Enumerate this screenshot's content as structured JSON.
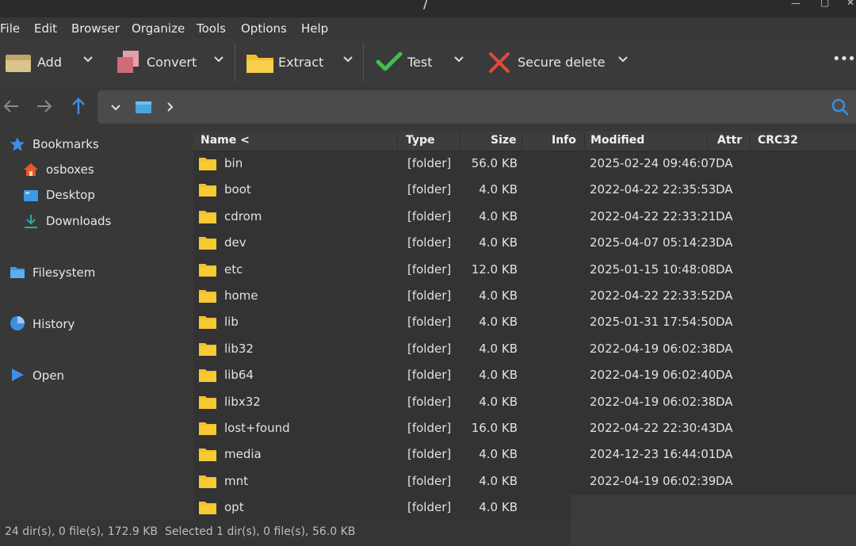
{
  "window": {
    "title": "/"
  },
  "menu": [
    "File",
    "Edit",
    "Browser",
    "Organize",
    "Tools",
    "Options",
    "Help"
  ],
  "toolbar": {
    "add": "Add",
    "convert": "Convert",
    "extract": "Extract",
    "test": "Test",
    "secure_delete": "Secure delete",
    "more": "•••"
  },
  "sidebar": {
    "bookmarks": "Bookmarks",
    "bookmark_items": [
      "osboxes",
      "Desktop",
      "Downloads"
    ],
    "filesystem": "Filesystem",
    "history": "History",
    "open": "Open"
  },
  "columns": {
    "name": "Name <",
    "type": "Type",
    "size": "Size",
    "info": "Info",
    "modified": "Modified",
    "attr": "Attr",
    "crc32": "CRC32"
  },
  "files": [
    {
      "name": "bin",
      "type": "[folder]",
      "size": "56.0 KB",
      "modified": "2025-02-24 09:46:07",
      "attr": "DA"
    },
    {
      "name": "boot",
      "type": "[folder]",
      "size": "4.0 KB",
      "modified": "2022-04-22 22:35:53",
      "attr": "DA"
    },
    {
      "name": "cdrom",
      "type": "[folder]",
      "size": "4.0 KB",
      "modified": "2022-04-22 22:33:21",
      "attr": "DA"
    },
    {
      "name": "dev",
      "type": "[folder]",
      "size": "4.0 KB",
      "modified": "2025-04-07 05:14:23",
      "attr": "DA"
    },
    {
      "name": "etc",
      "type": "[folder]",
      "size": "12.0 KB",
      "modified": "2025-01-15 10:48:08",
      "attr": "DA"
    },
    {
      "name": "home",
      "type": "[folder]",
      "size": "4.0 KB",
      "modified": "2022-04-22 22:33:52",
      "attr": "DA"
    },
    {
      "name": "lib",
      "type": "[folder]",
      "size": "4.0 KB",
      "modified": "2025-01-31 17:54:50",
      "attr": "DA"
    },
    {
      "name": "lib32",
      "type": "[folder]",
      "size": "4.0 KB",
      "modified": "2022-04-19 06:02:38",
      "attr": "DA"
    },
    {
      "name": "lib64",
      "type": "[folder]",
      "size": "4.0 KB",
      "modified": "2022-04-19 06:02:40",
      "attr": "DA"
    },
    {
      "name": "libx32",
      "type": "[folder]",
      "size": "4.0 KB",
      "modified": "2022-04-19 06:02:38",
      "attr": "DA"
    },
    {
      "name": "lost+found",
      "type": "[folder]",
      "size": "16.0 KB",
      "modified": "2022-04-22 22:30:43",
      "attr": "DA"
    },
    {
      "name": "media",
      "type": "[folder]",
      "size": "4.0 KB",
      "modified": "2024-12-23 16:44:01",
      "attr": "DA"
    },
    {
      "name": "mnt",
      "type": "[folder]",
      "size": "4.0 KB",
      "modified": "2022-04-19 06:02:39",
      "attr": "DA"
    },
    {
      "name": "opt",
      "type": "[folder]",
      "size": "4.0 KB",
      "modified": "",
      "attr": ""
    }
  ],
  "status": {
    "summary": "24 dir(s), 0 file(s), 172.9 KB",
    "selection": "Selected 1 dir(s), 0 file(s), 56.0 KB"
  },
  "colors": {
    "folder": "#f2bf2f",
    "accent_blue": "#3d8ee6",
    "check_green": "#3fbf4f",
    "delete_red": "#e04a3a"
  }
}
